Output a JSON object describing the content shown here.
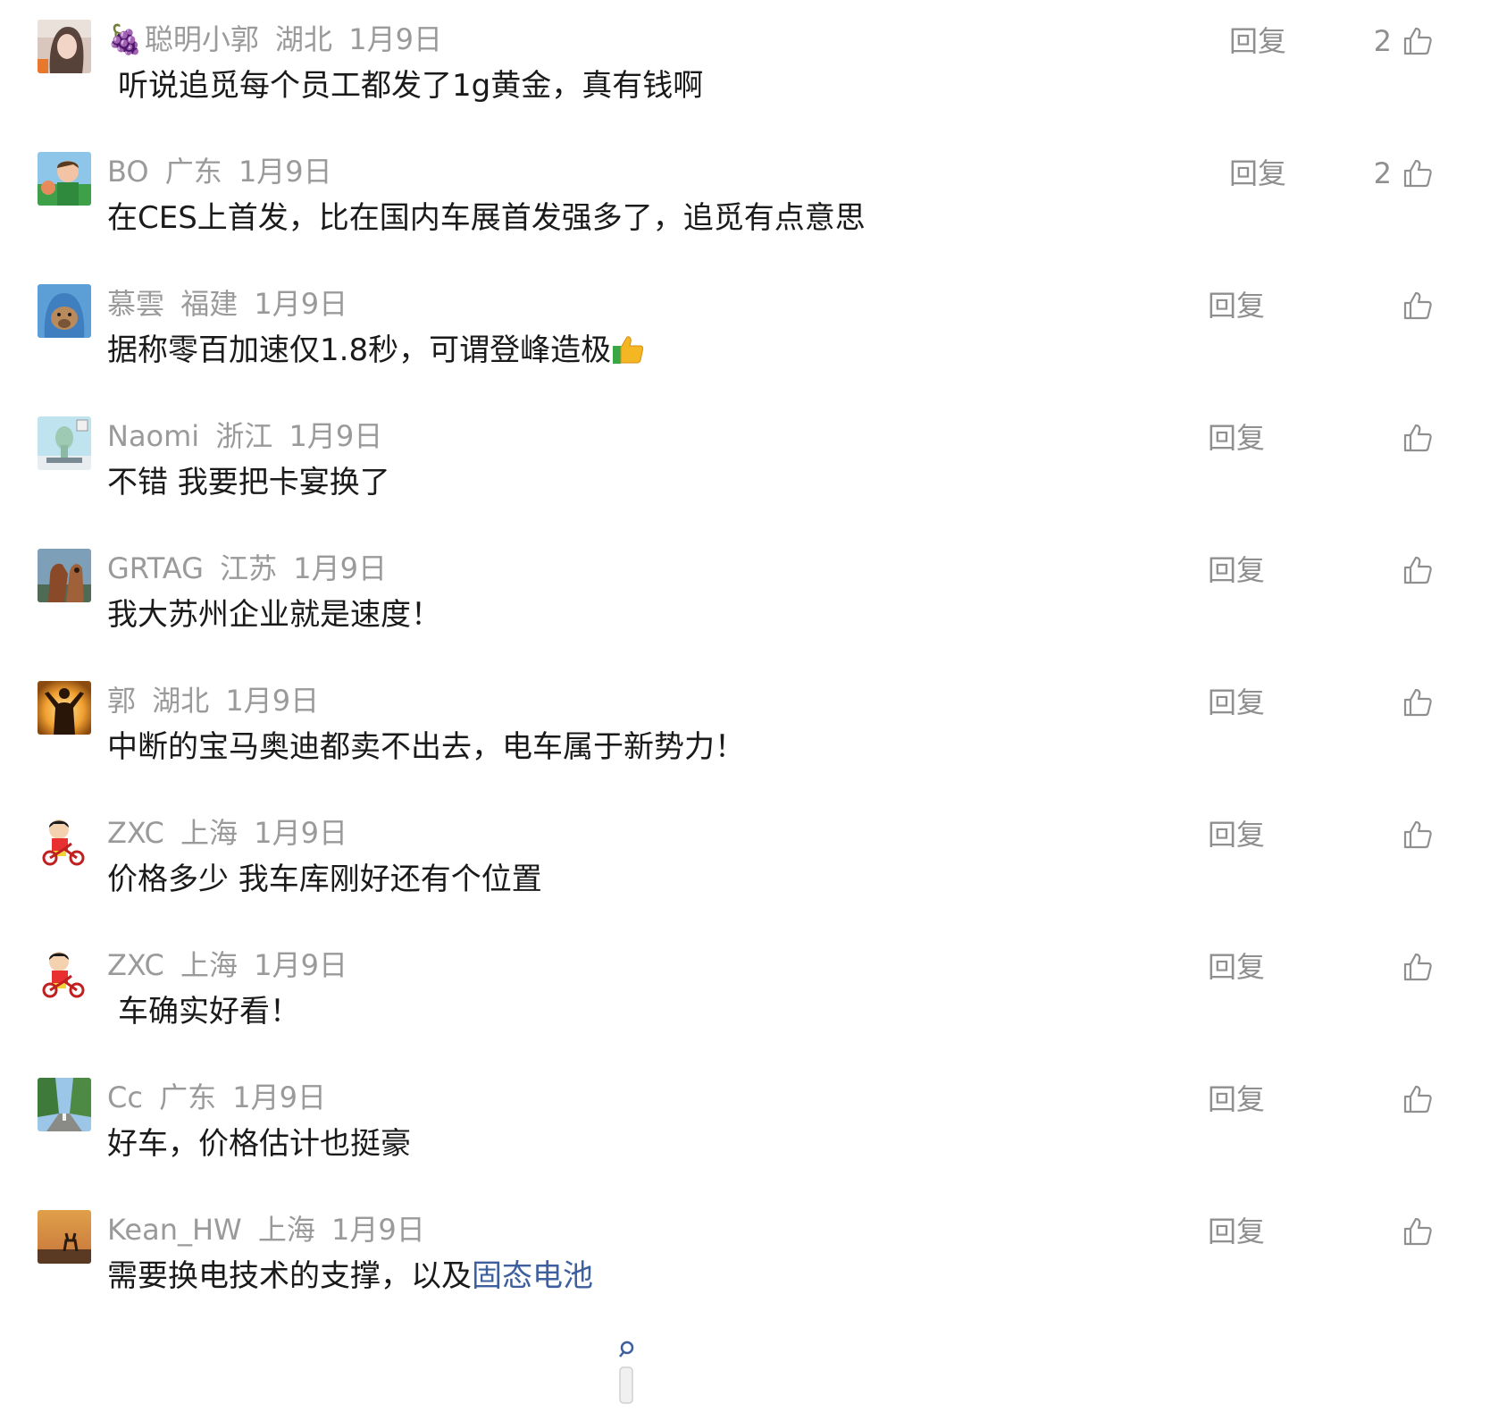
{
  "reply_label": "回复",
  "comments": [
    {
      "badge": "🍇",
      "user": "聪明小郭",
      "region": "湖北",
      "date": "1月9日",
      "text": "听说追觅每个员工都发了1g黄金，真有钱啊",
      "likes": "2",
      "avatar_icon": "portrait-photo-avatar"
    },
    {
      "user": "BO",
      "region": "广东",
      "date": "1月9日",
      "text": "在CES上首发，比在国内车展首发强多了，追觅有点意思",
      "likes": "2",
      "avatar_icon": "cartoon-avatar"
    },
    {
      "user": "慕雲",
      "region": "福建",
      "date": "1月9日",
      "text": "据称零百加速仅1.8秒，可谓登峰造极",
      "likes": "",
      "avatar_icon": "bear-hoodie-avatar"
    },
    {
      "user": "Naomi",
      "region": "浙江",
      "date": "1月9日",
      "text": "不错 我要把卡宴换了",
      "likes": "",
      "avatar_icon": "squidward-avatar"
    },
    {
      "user": "GRTAG",
      "region": "江苏",
      "date": "1月9日",
      "text": "我大苏州企业就是速度！",
      "likes": "",
      "avatar_icon": "horse-avatar"
    },
    {
      "user": "郭",
      "region": "湖北",
      "date": "1月9日",
      "text": "中断的宝马奥迪都卖不出去，电车属于新势力！",
      "likes": "",
      "avatar_icon": "sunset-silhouette-avatar"
    },
    {
      "user": "ZXC",
      "region": "上海",
      "date": "1月9日",
      "text": "价格多少 我车库刚好还有个位置",
      "likes": "",
      "avatar_icon": "crayon-shin-chan-avatar"
    },
    {
      "user": "ZXC",
      "region": "上海",
      "date": "1月9日",
      "text": "车确实好看！",
      "likes": "",
      "avatar_icon": "crayon-shin-chan-avatar"
    },
    {
      "user": "Cc",
      "region": "广东",
      "date": "1月9日",
      "text": "好车，价格估计也挺豪",
      "likes": "",
      "avatar_icon": "forest-road-avatar"
    },
    {
      "user": "Kean_HW",
      "region": "上海",
      "date": "1月9日",
      "text_prefix": "需要换电技术的支撑，以及",
      "text_link": "固态电池",
      "likes": "",
      "avatar_icon": "deer-sunset-avatar"
    }
  ],
  "colors": {
    "meta": "#9a9a9a",
    "text": "#1a1a1a",
    "link": "#3d5f9e",
    "action": "#8f8f8f"
  }
}
